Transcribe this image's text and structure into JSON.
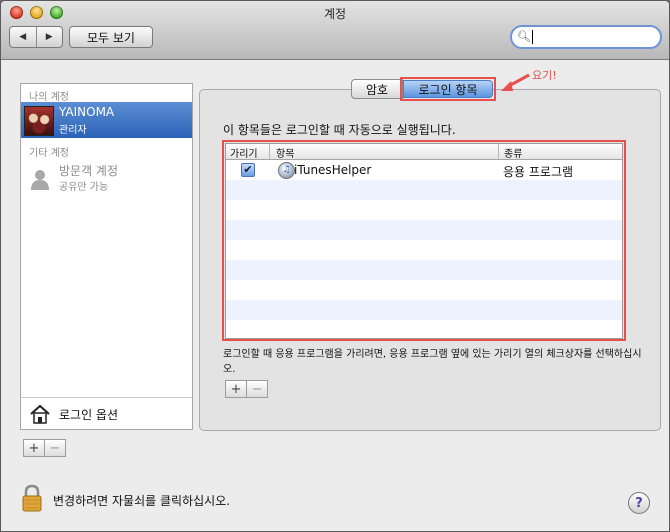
{
  "window": {
    "title": "계정"
  },
  "toolbar": {
    "back_glyph": "◀",
    "forward_glyph": "▶",
    "show_all_label": "모두 보기",
    "search": {
      "value": "",
      "placeholder": ""
    }
  },
  "sidebar": {
    "my_account_header": "나의 계정",
    "current_user": {
      "name": "YAINOMA",
      "role": "관리자"
    },
    "other_accounts_header": "기타 계정",
    "guest": {
      "name": "방문객 계정",
      "sub": "공유만 가능"
    },
    "login_options_label": "로그인 옵션",
    "add_glyph": "+",
    "remove_glyph": "−"
  },
  "tabs": [
    {
      "label": "암호",
      "selected": false
    },
    {
      "label": "로그인 항목",
      "selected": true
    }
  ],
  "annotation": {
    "text": "요기!",
    "color": "#e8504d"
  },
  "login_items": {
    "description": "이 항목들은 로그인할 때 자동으로 실행됩니다.",
    "columns": [
      "가리기",
      "항목",
      "종류"
    ],
    "rows": [
      {
        "hide": true,
        "check_glyph": "✔",
        "icon_glyph": "♫",
        "name": "iTunesHelper",
        "kind": "응용 프로그램"
      }
    ],
    "hint": "로그인할 때 응용 프로그램을 가리려면, 응용 프로그램 옆에 있는 가리기 열의 체크상자를 선택하십시오.",
    "add_glyph": "+",
    "remove_glyph": "−"
  },
  "footer": {
    "lock_text": "변경하려면 자물쇠를 클릭하십시오.",
    "help_glyph": "?"
  }
}
